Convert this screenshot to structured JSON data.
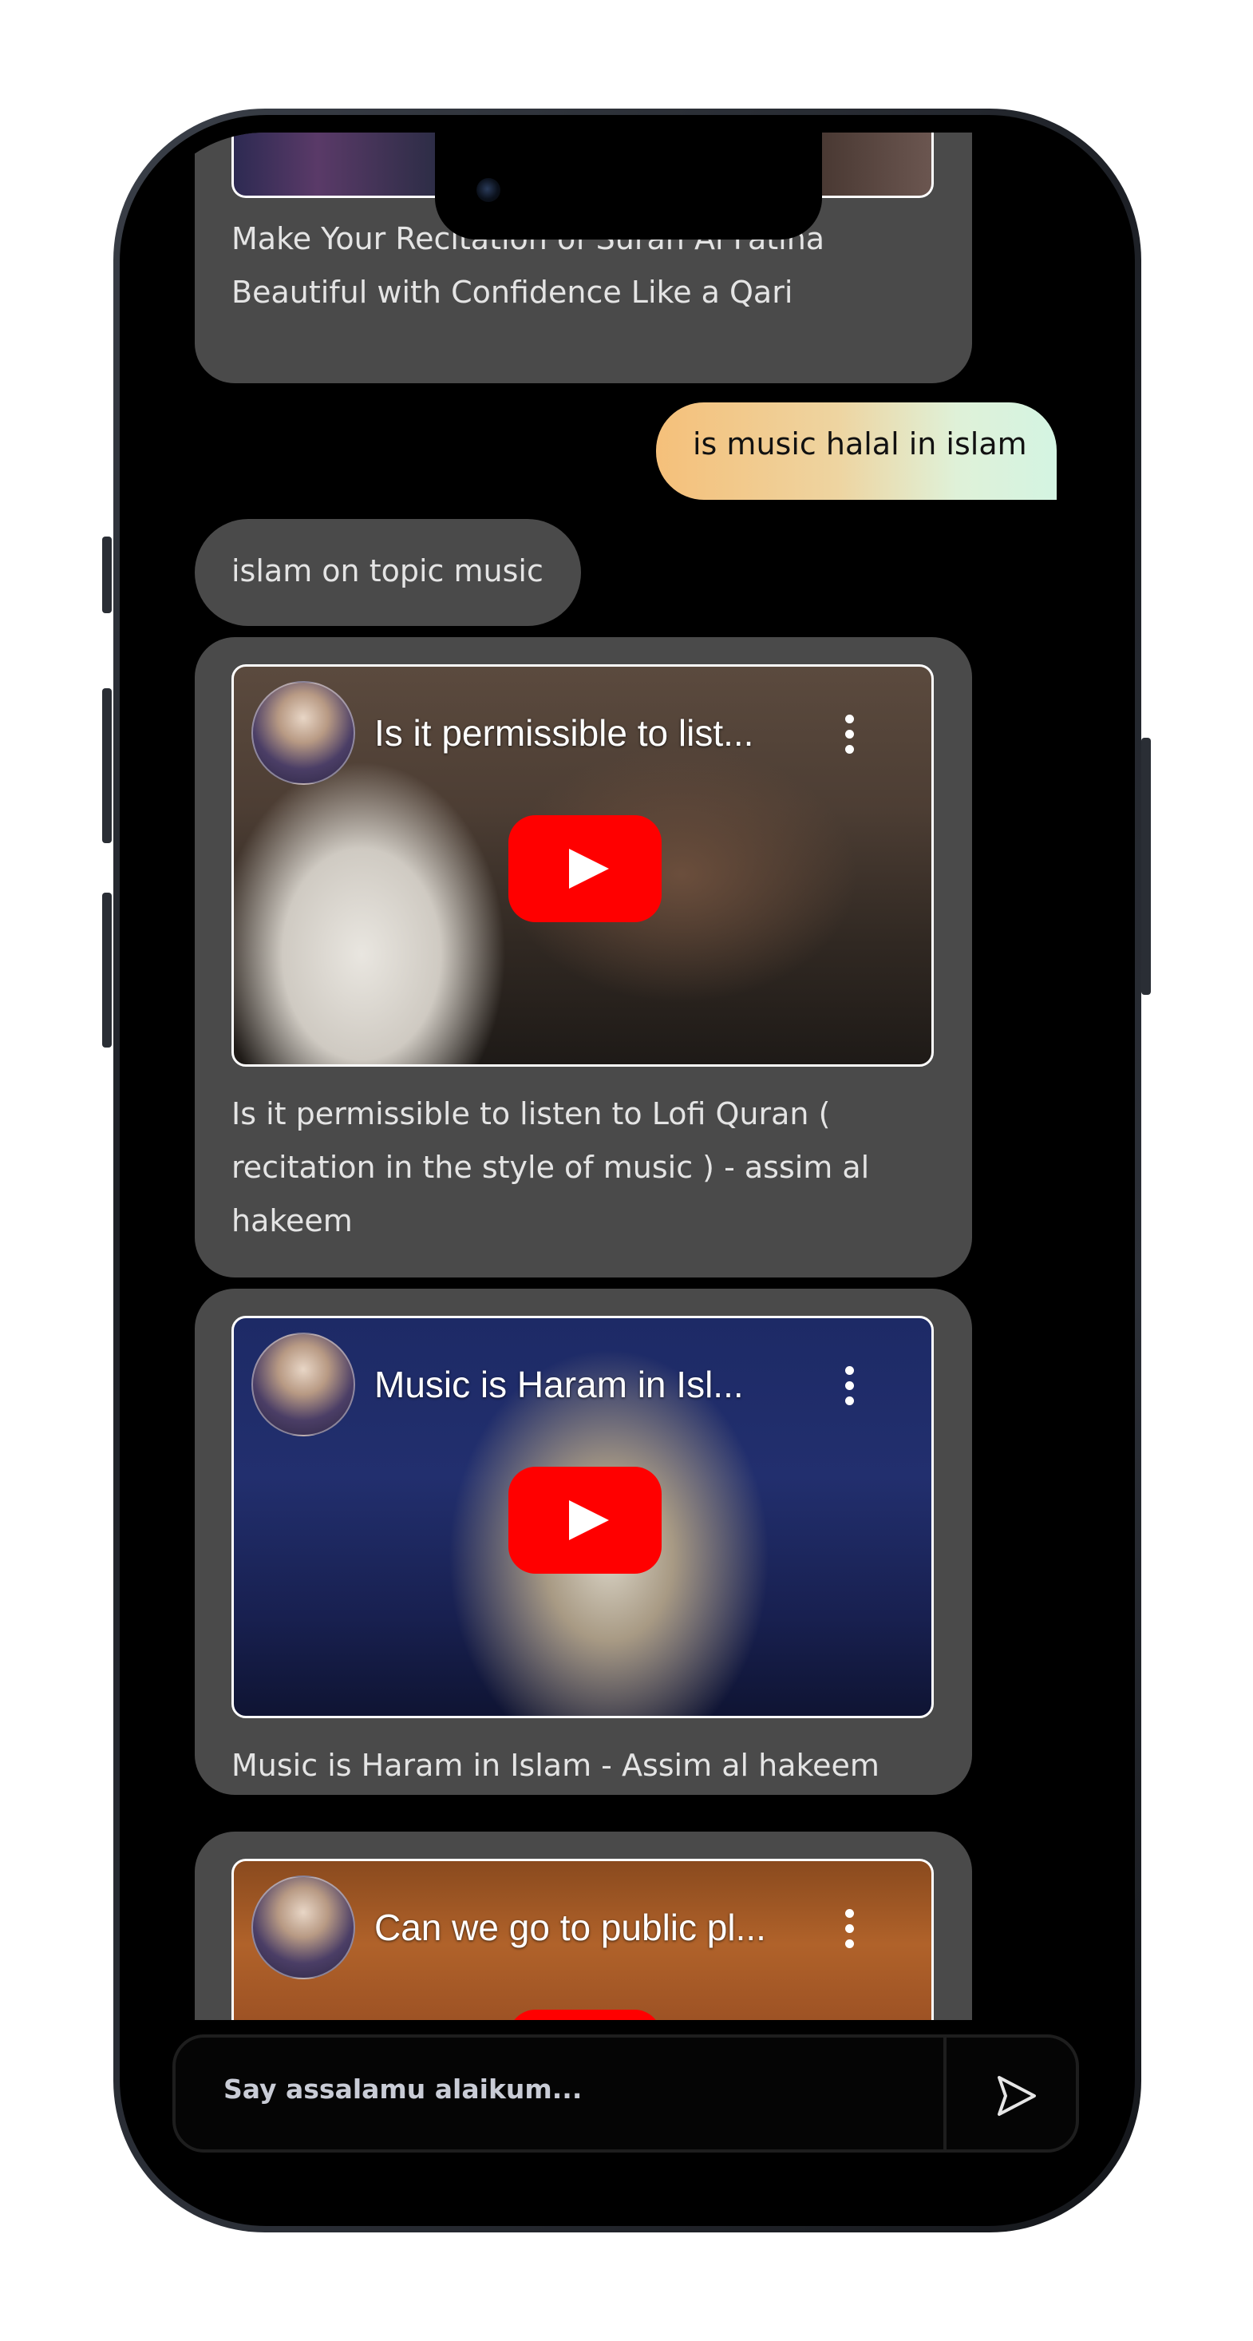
{
  "chat": {
    "messages": [
      {
        "role": "bot",
        "type": "video",
        "caption": "Make Your Recitation of Surah Al Fatiha Beautiful with Confidence Like a Qari"
      },
      {
        "role": "user",
        "type": "text",
        "text": "is music halal in islam"
      },
      {
        "role": "bot",
        "type": "text",
        "text": "islam on topic music"
      },
      {
        "role": "bot",
        "type": "video",
        "video_title": "Is it permissible to list...",
        "caption": "Is it permissible to listen to Lofi Quran ( recitation in the style of music ) - assim al hakeem"
      },
      {
        "role": "bot",
        "type": "video",
        "video_title": "Music is Haram in Isl...",
        "caption": "Music is Haram in Islam - Assim al hakeem"
      },
      {
        "role": "bot",
        "type": "video",
        "video_title": "Can we go to public pl...",
        "caption": ""
      }
    ]
  },
  "input": {
    "placeholder": "Say assalamu alaikum...",
    "value": ""
  },
  "icons": {
    "send": "send-icon",
    "play": "youtube-play-icon",
    "menu": "more-vert-icon"
  },
  "colors": {
    "background": "#000000",
    "bot_bubble": "#4a4a4a",
    "user_bubble_start": "#f5c27c",
    "user_bubble_end": "#d9f4e4",
    "youtube_red": "#ff0000"
  }
}
